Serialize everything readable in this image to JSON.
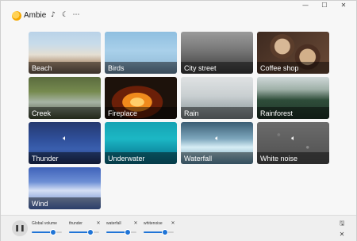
{
  "app": {
    "title": "Ambie",
    "title_icons": [
      "music-note-icon",
      "moon-icon",
      "more-icon"
    ],
    "window_controls": [
      "minimize-icon",
      "maximize-icon",
      "close-icon"
    ]
  },
  "sounds": [
    {
      "label": "Beach",
      "id": "beach",
      "playing": false
    },
    {
      "label": "Birds",
      "id": "birds",
      "playing": false
    },
    {
      "label": "City street",
      "id": "city",
      "playing": false
    },
    {
      "label": "Coffee shop",
      "id": "coffee",
      "playing": false
    },
    {
      "label": "Creek",
      "id": "creek",
      "playing": false
    },
    {
      "label": "Fireplace",
      "id": "fireplace",
      "playing": false
    },
    {
      "label": "Rain",
      "id": "rain",
      "playing": false
    },
    {
      "label": "Rainforest",
      "id": "rainforest",
      "playing": false
    },
    {
      "label": "Thunder",
      "id": "thunder",
      "playing": true
    },
    {
      "label": "Underwater",
      "id": "underwater",
      "playing": false
    },
    {
      "label": "Waterfall",
      "id": "waterfall",
      "playing": true
    },
    {
      "label": "White noise",
      "id": "white-noise",
      "playing": true
    },
    {
      "label": "Wind",
      "id": "wind",
      "playing": false
    }
  ],
  "player": {
    "pause_icon": "pause-icon",
    "global": {
      "label": "Global volume",
      "value": 0.72
    },
    "channels": [
      {
        "label": "thunder",
        "value": 0.72
      },
      {
        "label": "waterfall",
        "value": 0.72
      },
      {
        "label": "whitenoise",
        "value": 0.72
      }
    ],
    "save_icon": "save-icon",
    "clear_icon": "clear-icon"
  },
  "colors": {
    "accent": "#1f74d6",
    "logo": "#f5a800"
  }
}
